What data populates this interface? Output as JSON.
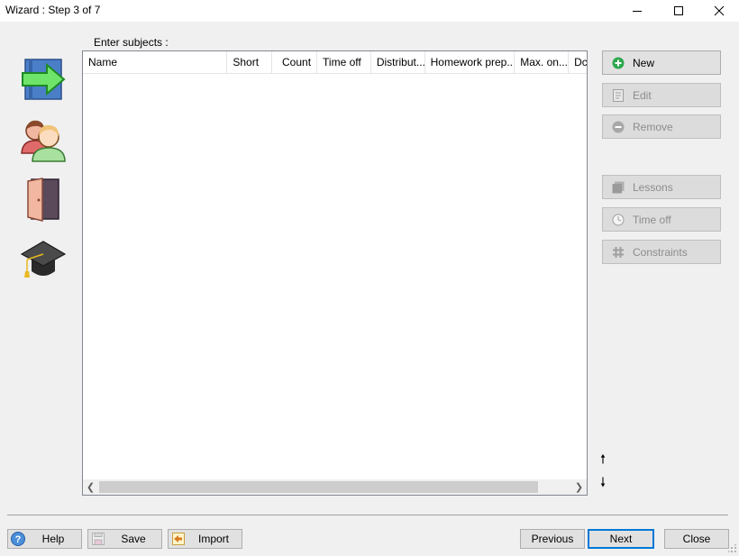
{
  "window": {
    "title": "Wizard : Step 3 of 7"
  },
  "sidebar": {
    "icons": [
      "next-step-arrow-icon",
      "teachers-icon",
      "rooms-door-icon",
      "subjects-graduation-cap-icon"
    ]
  },
  "grid": {
    "label": "Enter subjects :",
    "columns": [
      "Name",
      "Short",
      "Count",
      "Time off",
      "Distribut...",
      "Homework prep...",
      "Max. on...",
      "Dc"
    ],
    "rows": []
  },
  "actions": {
    "new": "New",
    "edit": "Edit",
    "remove": "Remove",
    "lessons": "Lessons",
    "time_off": "Time off",
    "constraints": "Constraints"
  },
  "footer": {
    "help": "Help",
    "save": "Save",
    "import": "Import",
    "previous": "Previous",
    "next": "Next",
    "close": "Close"
  },
  "colors": {
    "accent": "#0078d7",
    "new_icon": "#2fa84f",
    "grid_border": "#828790"
  }
}
